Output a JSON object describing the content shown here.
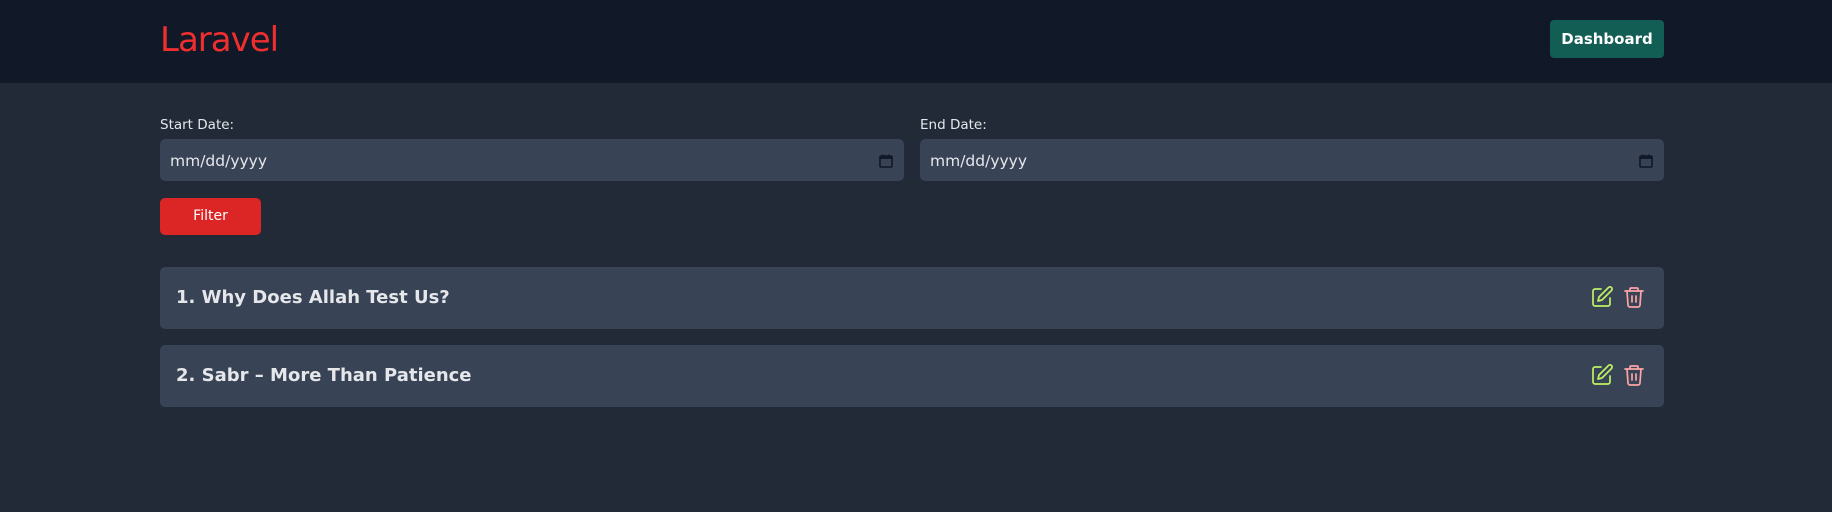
{
  "header": {
    "logo_text": "Laravel",
    "dashboard_label": "Dashboard"
  },
  "filters": {
    "start_date": {
      "label": "Start Date:",
      "value": "mm/dd/yyyy"
    },
    "end_date": {
      "label": "End Date:",
      "value": "mm/dd/yyyy"
    },
    "filter_label": "Filter"
  },
  "posts": [
    {
      "title": "1. Why Does Allah Test Us?"
    },
    {
      "title": "2. Sabr – More Than Patience"
    }
  ],
  "colors": {
    "header_bg": "#111827",
    "page_bg": "#222a38",
    "brand": "#ef2f2f",
    "dashboard_button": "#125e55",
    "filter_button": "#dc2626",
    "edit_icon": "#bef264",
    "delete_icon": "#fca5a5"
  },
  "icons": {
    "calendar": "calendar-icon",
    "edit": "edit-icon",
    "delete": "trash-icon"
  }
}
